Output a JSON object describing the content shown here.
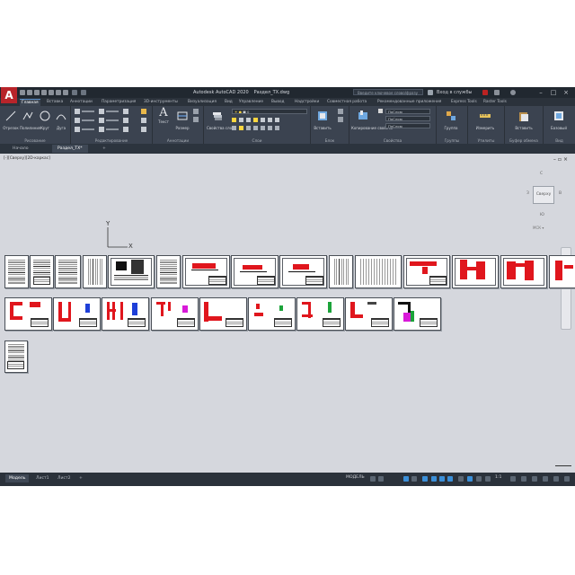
{
  "app": {
    "logo": "A",
    "title": "Autodesk AutoCAD 2020",
    "filename": "Раздел_ТХ.dwg",
    "search_placeholder": "Введите ключевое слово/фразу",
    "signin": "Вход в службы"
  },
  "ribbon_tabs": [
    "Главная",
    "Вставка",
    "Аннотации",
    "Параметризация",
    "3D-инструменты",
    "Визуализация",
    "Вид",
    "Управление",
    "Вывод",
    "Надстройки",
    "Совместная работа",
    "Рекомендованные приложения",
    "Express Tools",
    "Raster Tools"
  ],
  "ribbon": {
    "draw": {
      "line": "Отрезок",
      "polyline": "Полилиния",
      "circle": "Круг",
      "arc": "Дуга",
      "label": "Рисование"
    },
    "modify": {
      "label": "Редактирование"
    },
    "annotation": {
      "text": "Текст",
      "dimension": "Размер",
      "label": "Аннотации"
    },
    "layers": {
      "properties": "Свойства слоя",
      "label": "Слои"
    },
    "block": {
      "insert": "Вставить",
      "label": "Блок"
    },
    "properties": {
      "match": "Копирование свойств",
      "layer_combo": "ПоСлою",
      "linetype_combo": "ПоСлою",
      "lineweight_combo": "ПоСлою",
      "label": "Свойства"
    },
    "groups": {
      "group": "Группа",
      "label": "Группы"
    },
    "utilities": {
      "measure": "Измерить",
      "label": "Утилиты"
    },
    "clipboard": {
      "paste": "Вставить",
      "label": "Буфер обмена"
    },
    "view": {
      "base": "Базовый",
      "label": "Вид"
    }
  },
  "doc_tabs": [
    "Начало",
    "Раздел_ТХ*"
  ],
  "viewport": {
    "label": "[-][Сверху][2D-каркас]",
    "cube_face": "Сверху",
    "compass_n": "С",
    "compass_w": "З",
    "compass_e": "В",
    "compass_s": "Ю",
    "wcs": "МСК ▾"
  },
  "ucs": {
    "x": "X",
    "y": "Y"
  },
  "layout_tabs": [
    "Модель",
    "Лист1",
    "Лист2"
  ],
  "status": {
    "space": "МОДЕЛЬ",
    "scale": "1:1"
  },
  "colors": {
    "accent": "#3b8fd8",
    "pipe_red": "#e0161d",
    "logo_red": "#b8242a"
  }
}
